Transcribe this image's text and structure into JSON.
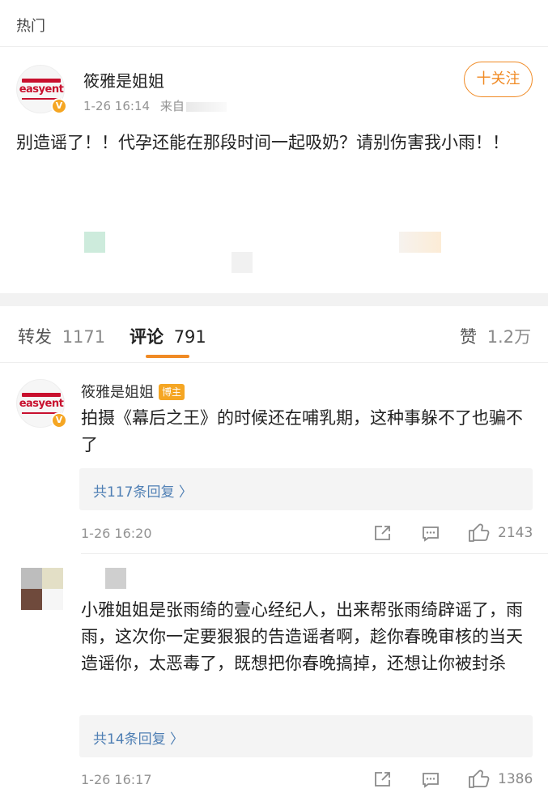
{
  "section": {
    "title": "热门"
  },
  "post": {
    "author": "筱雅是姐姐",
    "avatar_logo": "easyent",
    "time": "1-26 16:14",
    "source_prefix": "来自",
    "follow_label": "十关注",
    "content": "别造谣了！！代孕还能在那段时间一起吸奶？请别伤害我小雨！！"
  },
  "tabs": {
    "repost": {
      "label": "转发",
      "count": "1171"
    },
    "comment": {
      "label": "评论",
      "count": "791"
    },
    "like": {
      "label": "赞",
      "count": "1.2万"
    }
  },
  "comments": [
    {
      "author": "筱雅是姐姐",
      "badge": "博主",
      "text": "拍摄《幕后之王》的时候还在哺乳期，这种事躲不了也骗不了",
      "replies": "共117条回复 〉",
      "time": "1-26 16:20",
      "likes": "2143"
    },
    {
      "author": "",
      "text": "小雅姐姐是张雨绮的壹心经纪人，出来帮张雨绮辟谣了，雨雨，这次你一定要狠狠的告造谣者啊，趁你春晚审核的当天造谣你，太恶毒了，既想把你春晚搞掉，还想让你被封杀",
      "replies": "共14条回复 〉",
      "time": "1-26 16:17",
      "likes": "1386"
    }
  ],
  "colors": {
    "accent": "#f08a24",
    "link": "#4f7fb4",
    "verified": "#f5a623",
    "brand_red": "#c8102e"
  },
  "icons": [
    "verified-icon",
    "share-icon",
    "comment-icon",
    "like-icon",
    "chevron-right-icon"
  ]
}
